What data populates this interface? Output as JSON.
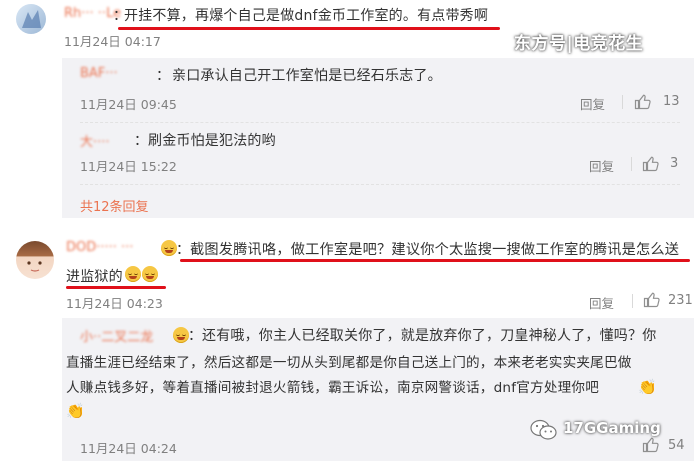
{
  "watermarks": {
    "top_right": "东方号|电竞花生",
    "bottom_right": "17GGaming"
  },
  "comments": [
    {
      "user": "Rh··· ··Le",
      "text": "开挂不算，再爆个自己是做dnf金币工作室的。有点带秀啊",
      "time": "11月24日 04:17"
    }
  ],
  "replies_1": [
    {
      "user": "BAF···",
      "text": "亲口承认自己开工作室怕是已经石乐志了。",
      "time": "11月24日 09:45",
      "reply": "回复",
      "likes": "13"
    },
    {
      "user": "大····",
      "text": "刷金币怕是犯法的哟",
      "time": "11月24日 15:22",
      "reply": "回复",
      "likes": "3"
    }
  ],
  "more_replies": "共12条回复",
  "comment_2": {
    "user": "DOD·····  ···",
    "line1": "截图发腾讯咯，做工作室是吧？建议你个太监搜一搜做工作室的腾讯是怎么送",
    "line2": "进监狱的",
    "time": "11月24日 04:23",
    "reply": "回复",
    "likes": "231"
  },
  "reply_2": {
    "user": "小··二叉二龙",
    "line1": "还有哦，你主人已经取关你了，就是放弃你了，刀皇神秘人了，懂吗？你",
    "line2": "直播生涯已经结束了，然后这都是一切从头到尾都是你自己送上门的，本来老老实实夹尾巴做",
    "line3": "人赚点钱多好，等着直播间被封退火箭钱，霸王诉讼，南京网警谈话，dnf官方处理你吧",
    "time": "11月24日 04:24",
    "likes": "54"
  },
  "colors": {
    "accent": "#eb7350",
    "underline": "#e0101a",
    "reply_bg": "#f2f2f5"
  }
}
